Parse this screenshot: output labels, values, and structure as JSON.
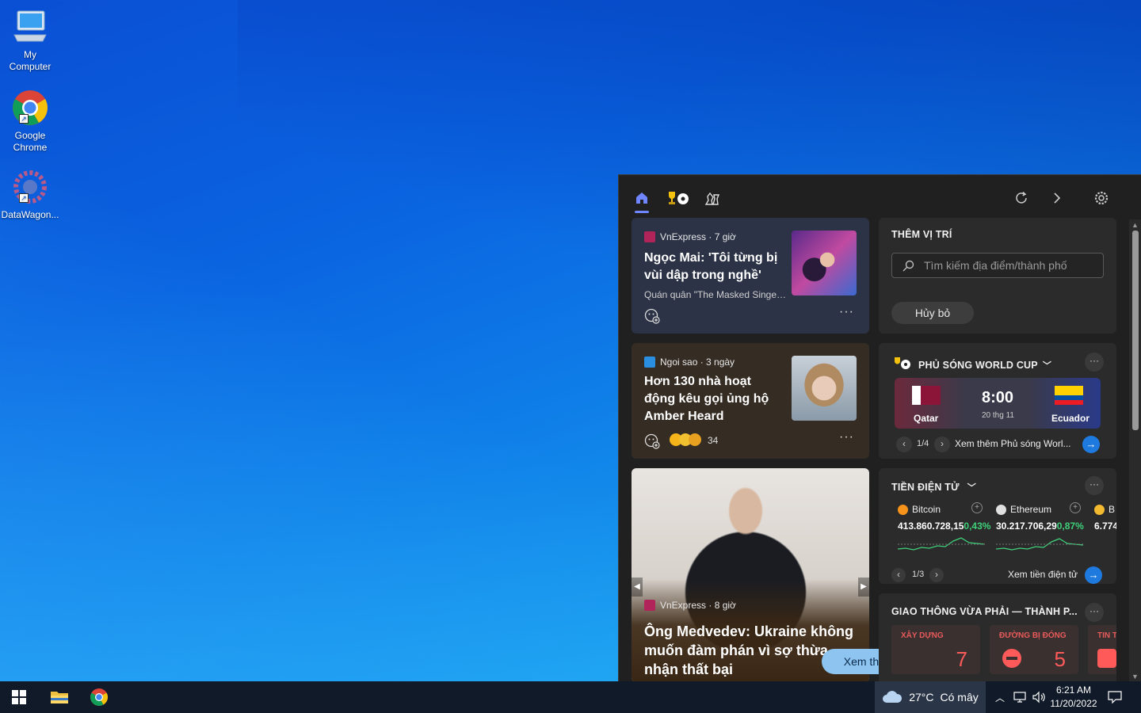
{
  "desktop": {
    "icons": [
      {
        "label": "My\nComputer",
        "icon": "computer-icon"
      },
      {
        "label": "Google\nChrome",
        "icon": "chrome-icon"
      },
      {
        "label": "DataWagon...",
        "icon": "datawagon-icon"
      }
    ]
  },
  "panel": {
    "tabs": [
      "home-icon",
      "world-cup-icon",
      "chess-icon"
    ],
    "toolbar": [
      "refresh-icon",
      "forward-icon",
      "settings-icon"
    ],
    "accent": "#6f86ff",
    "news": [
      {
        "source": "VnExpress · 7 giờ",
        "title": "Ngọc Mai: 'Tôi từng bị vùi dập trong nghề'",
        "desc": "Quán quân \"The Masked Singer...",
        "source_color": "#b0245a"
      },
      {
        "source": "Ngoi sao · 3 ngày",
        "title": "Hơn 130 nhà hoạt động kêu gọi ủng hộ Amber Heard",
        "reactions": "34",
        "source_color": "#2a8fe0"
      },
      {
        "source": "VnExpress · 8 giờ",
        "title": "Ông Medvedev: Ukraine không muốn đàm phán vì sợ thừa nhận thất bại"
      }
    ],
    "see_more": "Xem thêm",
    "location": {
      "header": "THÊM VỊ TRÍ",
      "placeholder": "Tìm kiếm địa điểm/thành phố",
      "cancel": "Hủy bỏ"
    },
    "worldcup": {
      "header": "PHỦ SÓNG WORLD CUP",
      "team_a": "Qatar",
      "team_b": "Ecuador",
      "time": "8:00",
      "date": "20 thg 11",
      "pager": "1/4",
      "more_link": "Xem thêm Phủ sóng Worl..."
    },
    "crypto": {
      "header": "TIỀN ĐIỆN TỬ",
      "coins": [
        {
          "name": "Bitcoin",
          "value": "413.860.728,15",
          "change": "0,43%",
          "color": "#f7931a"
        },
        {
          "name": "Ethereum",
          "value": "30.217.706,29",
          "change": "0,87%",
          "color": "#e0e0e0"
        },
        {
          "name": "B",
          "value": "6.774",
          "change": "",
          "color": "#f3ba2f"
        }
      ],
      "pager": "1/3",
      "more_link": "Xem tiền điện tử"
    },
    "traffic": {
      "header": "GIAO THÔNG VỪA PHẢI — THÀNH P...",
      "items": [
        {
          "label": "XÂY DỰNG",
          "count": "7"
        },
        {
          "label": "ĐƯỜNG BỊ ĐÓNG",
          "count": "5"
        },
        {
          "label": "TIN T",
          "count": ""
        }
      ]
    }
  },
  "taskbar": {
    "weather_temp": "27°C",
    "weather_text": "Có mây",
    "time": "6:21 AM",
    "date": "11/20/2022"
  }
}
